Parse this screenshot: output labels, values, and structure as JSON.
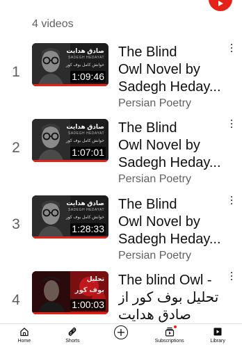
{
  "header": {
    "video_count": "4 videos"
  },
  "colors": {
    "accent": "#e62117",
    "text_primary": "#0f0f0f",
    "text_secondary": "#606060"
  },
  "videos": [
    {
      "index": "1",
      "thumb_title": "صادق هدایت",
      "thumb_sub": "SADEGH HEDAYAT",
      "thumb_sub2": "خوانش کامل بوف کور",
      "duration": "1:09:46",
      "title_lines": [
        "The Blind",
        "Owl Novel by",
        "Sadegh Heday..."
      ],
      "channel": "Persian Poetry",
      "watched_fraction": 1.0
    },
    {
      "index": "2",
      "thumb_title": "صادق هدایت",
      "thumb_sub": "SADEGH HEDAYAT",
      "thumb_sub2": "خوانش کامل بوف کور",
      "duration": "1:07:01",
      "title_lines": [
        "The Blind",
        "Owl Novel by",
        "Sadegh Heday..."
      ],
      "channel": "Persian Poetry",
      "watched_fraction": 1.0
    },
    {
      "index": "3",
      "thumb_title": "صادق هدایت",
      "thumb_sub": "SADEGH HEDAYAT",
      "thumb_sub2": "خوانش کامل بوف کور",
      "duration": "1:28:33",
      "title_lines": [
        "The Blind",
        "Owl Novel by",
        "Sadegh Heday..."
      ],
      "channel": "Persian Poetry",
      "watched_fraction": 1.0
    },
    {
      "index": "4",
      "thumb_title": "تحلیل",
      "thumb_sub2": "بوف کور",
      "duration": "1:00:03",
      "title_lines": [
        "The blind Owl -",
        "تحلیل بوف کور از",
        "صادق هدایت"
      ],
      "channel": "",
      "watched_fraction": 1.0
    }
  ],
  "bottom_nav": {
    "home": "Home",
    "shorts": "Shorts",
    "subscriptions": "Subscriptions",
    "library": "Library"
  },
  "icons": {
    "fab": "youtube-play-icon",
    "home": "home-icon",
    "shorts": "shorts-icon",
    "create": "plus-icon",
    "subscriptions": "subscriptions-icon",
    "library": "library-icon",
    "more": "more-vertical-icon"
  }
}
